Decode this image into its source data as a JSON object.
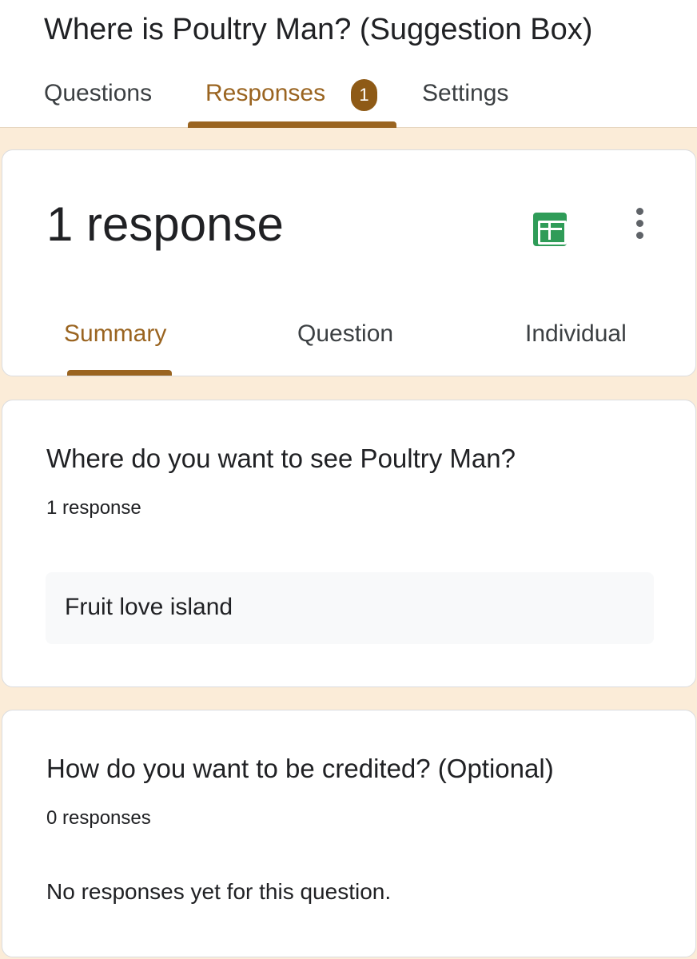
{
  "form": {
    "title": "Where is Poultry Man? (Suggestion Box)"
  },
  "tabs": {
    "questions": "Questions",
    "responses": "Responses",
    "responses_badge": "1",
    "settings": "Settings",
    "active": "Responses"
  },
  "summary_card": {
    "count_label": "1 response",
    "sheets_icon": "google-sheets-icon",
    "more_icon": "more-vert-icon",
    "subtabs": {
      "summary": "Summary",
      "question": "Question",
      "individual": "Individual",
      "active": "Summary"
    }
  },
  "questions": [
    {
      "title": "Where do you want to see Poultry Man?",
      "count": "1 response",
      "answers": [
        "Fruit love island"
      ]
    },
    {
      "title": "How do you want to be credited? (Optional)",
      "count": "0 responses",
      "empty_message": "No responses yet for this question."
    }
  ],
  "colors": {
    "accent": "#9a6420",
    "badge": "#8e5a16",
    "background": "#fbecd8",
    "sheets_green": "#2f9c58"
  }
}
